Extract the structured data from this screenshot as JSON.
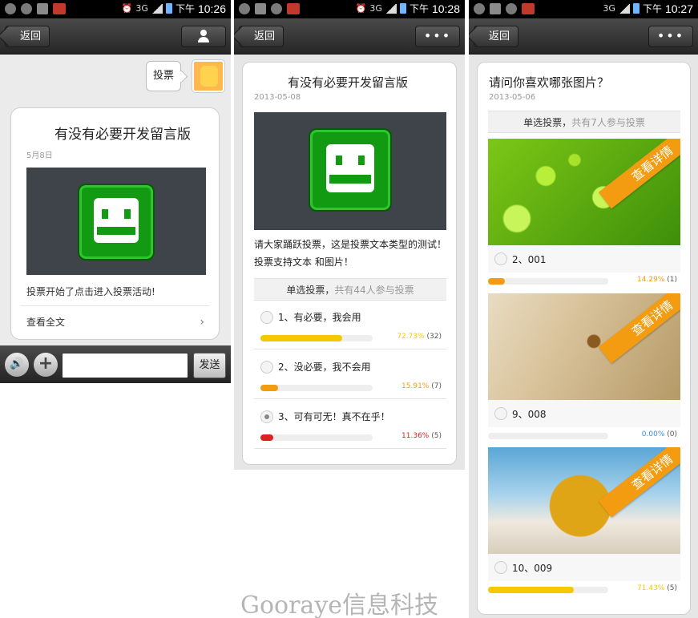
{
  "colors": {
    "bar_yellow": "#f5c800",
    "bar_orange": "#f39c12",
    "bar_red": "#e02020",
    "bar_blue": "#3a8ee6",
    "ribbon": "#f39c12"
  },
  "panels": [
    {
      "status": {
        "clock": "10:26",
        "ampm": "下午",
        "net": "3G"
      },
      "nav": {
        "back": "返回",
        "right_icon": "person-icon"
      },
      "chat": {
        "bubble_text": "投票",
        "card": {
          "title": "有没有必要开发留言版",
          "date": "5月8日",
          "desc": "投票开始了点击进入投票活动!",
          "read_all": "查看全文",
          "chevron": "›"
        }
      },
      "input": {
        "voice": "🔊",
        "plus": "+",
        "send": "发送"
      }
    },
    {
      "status": {
        "clock": "10:28",
        "ampm": "下午",
        "net": "3G"
      },
      "nav": {
        "back": "返回",
        "more": "•••"
      },
      "vote": {
        "title": "有没有必要开发留言版",
        "date": "2013-05-08",
        "desc": "请大家踊跃投票，这是投票文本类型的测试！投票支持文本 和图片！",
        "type": "单选投票，",
        "participants": "共有44人参与投票",
        "options": [
          {
            "label": "1、有必要，我会用",
            "pct": "72.73%",
            "count": "(32)",
            "value": 0.7273,
            "color": "#f5c800",
            "selected": false
          },
          {
            "label": "2、没必要，我不会用",
            "pct": "15.91%",
            "count": "(7)",
            "value": 0.1591,
            "color": "#f39c12",
            "selected": false
          },
          {
            "label": "3、可有可无！真不在乎！",
            "pct": "11.36%",
            "count": "(5)",
            "value": 0.1136,
            "color": "#e02020",
            "selected": true
          }
        ]
      }
    },
    {
      "status": {
        "clock": "10:27",
        "ampm": "下午",
        "net": "3G"
      },
      "nav": {
        "back": "返回",
        "more": "•••"
      },
      "vote": {
        "title": "请问你喜欢哪张图片？",
        "date": "2013-05-06",
        "type": "单选投票，",
        "participants": "共有7人参与投票",
        "ribbon": "查看详情",
        "options": [
          {
            "label": "2、001",
            "pct": "14.29%",
            "count": "(1)",
            "value": 0.1429,
            "color": "#f39c12"
          },
          {
            "label": "9、008",
            "pct": "0.00%",
            "count": "(0)",
            "value": 0.0,
            "color": "#3a8ee6"
          },
          {
            "label": "10、009",
            "pct": "71.43%",
            "count": "(5)",
            "value": 0.7143,
            "color": "#f5c800"
          }
        ]
      }
    }
  ],
  "watermark": "Gooraye信息科技"
}
